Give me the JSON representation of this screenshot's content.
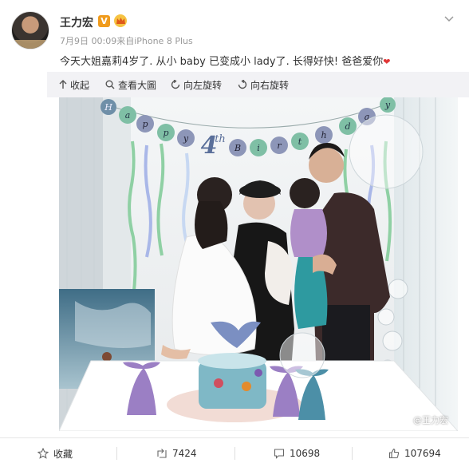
{
  "header": {
    "username": "王力宏",
    "verified_badge": "V",
    "meta": "7月9日 00:09来自iPhone 8 Plus",
    "avatar_icon": "avatar",
    "menu_icon": "chevron-down-icon"
  },
  "post": {
    "text": "今天大姐嘉莉4岁了. 从小 baby 已变成小 lady了. 长得好快! 爸爸爱你",
    "heart": "❤"
  },
  "toolbar": {
    "collapse_label": "收起",
    "view_large_label": "查看大圖",
    "rotate_left_label": "向左旋转",
    "rotate_right_label": "向右旋转"
  },
  "photo": {
    "banner_letters": [
      "H",
      "a",
      "p",
      "p",
      "y",
      "4th",
      "B",
      "i",
      "r",
      "t",
      "h",
      "d",
      "a",
      "y"
    ],
    "watermark": "@王力宏"
  },
  "footer": {
    "collect_label": "收藏",
    "repost_count": "7424",
    "comment_count": "10698",
    "like_count": "107694"
  },
  "colors": {
    "accent_orange": "#f09b1c",
    "text_primary": "#333333",
    "text_meta": "#999999",
    "toolbar_bg": "#f2f2f5"
  }
}
